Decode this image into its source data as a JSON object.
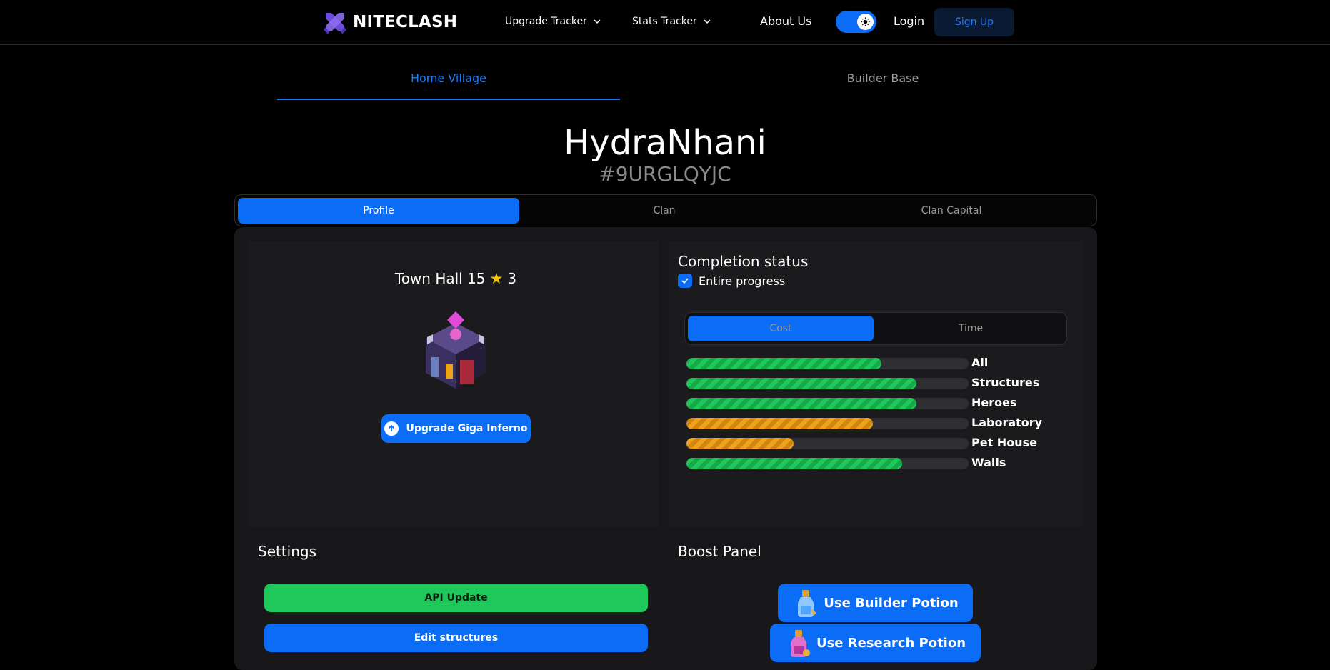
{
  "nav": {
    "brand": "NITECLASH",
    "upgrade_tracker": "Upgrade Tracker",
    "stats_tracker": "Stats Tracker",
    "about": "About Us",
    "login": "Login",
    "signup": "Sign Up",
    "theme_toggle_on": true
  },
  "village_tabs": {
    "home": "Home Village",
    "builder": "Builder Base",
    "active": "home"
  },
  "player": {
    "name": "HydraNhani",
    "tag": "#9URGLQYJC"
  },
  "profile_tabs": {
    "profile": "Profile",
    "clan": "Clan",
    "clan_capital": "Clan Capital",
    "active": "profile"
  },
  "town_hall": {
    "title": "Town Hall 15",
    "stars": "3",
    "upgrade_button": "Upgrade Giga Inferno"
  },
  "completion": {
    "title": "Completion status",
    "checkbox_label": "Entire progress",
    "checked": true,
    "tabs": {
      "cost": "Cost",
      "time": "Time",
      "active": "cost"
    },
    "bars": [
      {
        "label": "All",
        "progress": 0.69,
        "color": "green"
      },
      {
        "label": "Structures",
        "progress": 0.815,
        "color": "green"
      },
      {
        "label": "Heroes",
        "progress": 0.815,
        "color": "green"
      },
      {
        "label": "Laboratory",
        "progress": 0.66,
        "color": "orange"
      },
      {
        "label": "Pet House",
        "progress": 0.38,
        "color": "orange"
      },
      {
        "label": "Walls",
        "progress": 0.765,
        "color": "green"
      }
    ]
  },
  "settings": {
    "title": "Settings",
    "api_update": "API Update",
    "edit_structures": "Edit structures"
  },
  "boost": {
    "title": "Boost Panel",
    "builder_potion": "Use Builder Potion",
    "research_potion": "Use Research Potion"
  },
  "colors": {
    "accent": "#0b6cf5",
    "green": "#1ec85a",
    "orange": "#f0a21a",
    "background": "#000000",
    "panel": "#18181b"
  },
  "icons": [
    "crossed-swords-logo",
    "chevron-down-icon",
    "sun-icon",
    "star-icon",
    "arrow-up-circle-icon",
    "check-icon",
    "builder-potion-icon",
    "research-potion-icon",
    "town-hall-image"
  ]
}
